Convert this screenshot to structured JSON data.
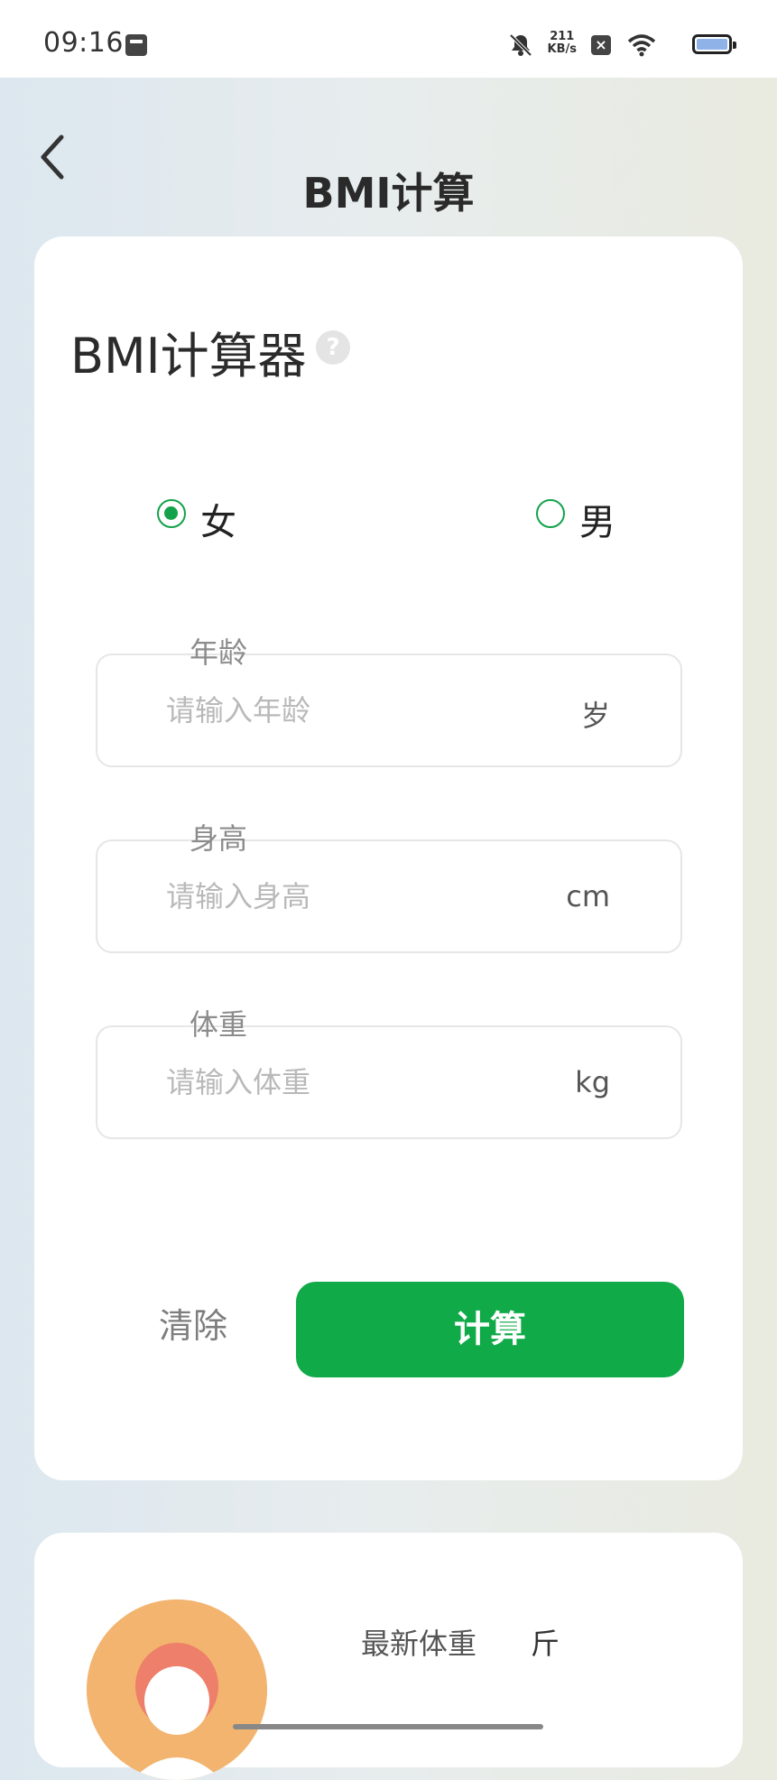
{
  "status_bar": {
    "time": "09:16",
    "net_speed_value": "211",
    "net_speed_unit": "KB/s",
    "icons": [
      "mail-icon",
      "bell-muted-icon",
      "close-box-icon",
      "wifi-icon",
      "battery-icon"
    ]
  },
  "header": {
    "title": "BMI计算"
  },
  "calculator": {
    "title": "BMI计算器",
    "help_symbol": "?",
    "gender": {
      "options": [
        {
          "label": "女",
          "selected": true
        },
        {
          "label": "男",
          "selected": false
        }
      ]
    },
    "fields": {
      "age": {
        "label": "年龄",
        "placeholder": "请输入年龄",
        "value": "",
        "unit": "岁"
      },
      "height": {
        "label": "身高",
        "placeholder": "请输入身高",
        "value": "",
        "unit": "cm"
      },
      "weight": {
        "label": "体重",
        "placeholder": "请输入体重",
        "value": "",
        "unit": "kg"
      }
    },
    "clear_label": "清除",
    "calc_label": "计算"
  },
  "summary": {
    "latest_weight_label": "最新体重",
    "latest_weight_unit": "斤"
  },
  "colors": {
    "accent": "#10aa48",
    "avatar_bg": "#f2b46e"
  }
}
